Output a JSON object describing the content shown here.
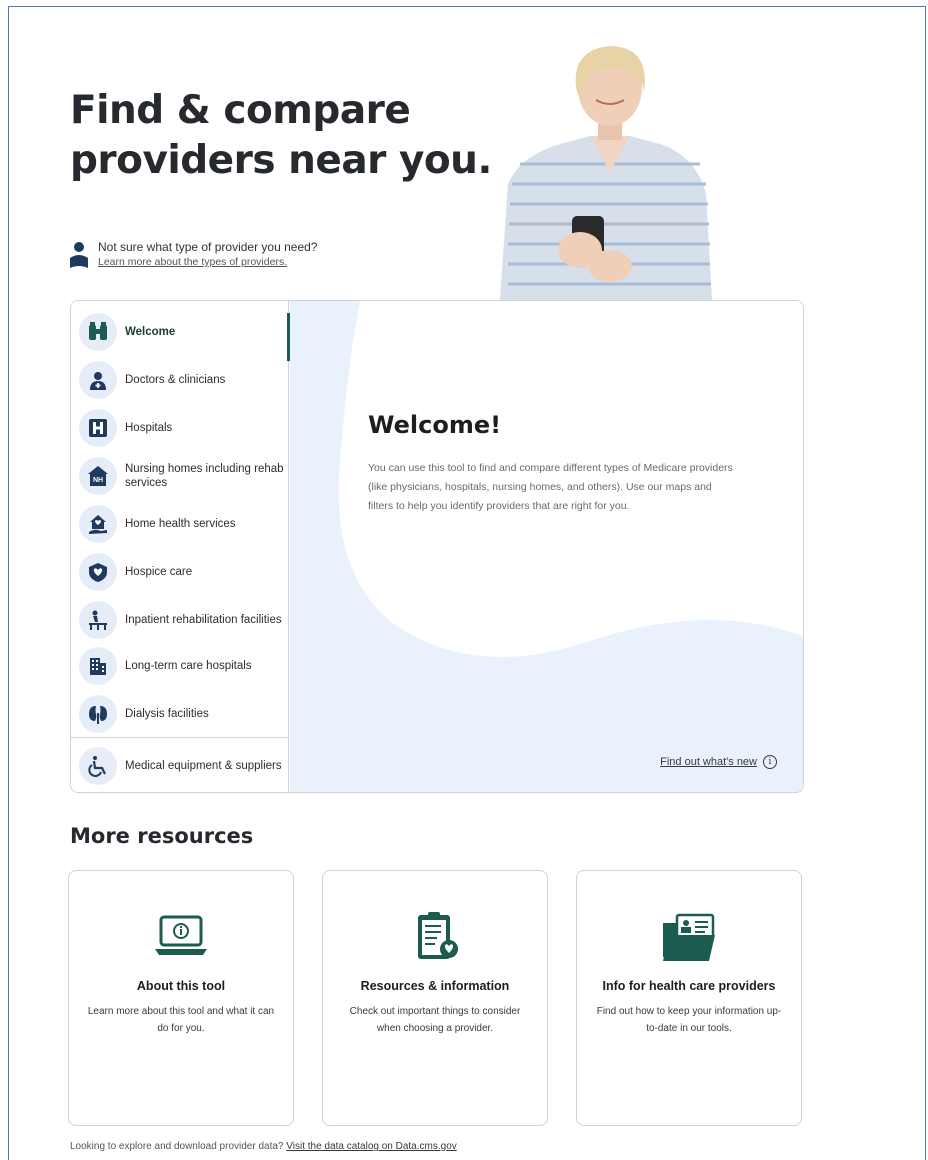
{
  "hero": {
    "title_line1": "Find & compare",
    "title_line2": "providers near you."
  },
  "help": {
    "question": "Not sure what type of provider you need?",
    "link": "Learn more about the types of providers."
  },
  "sidebar": {
    "items": [
      {
        "label": "Welcome",
        "icon": "binoculars-icon"
      },
      {
        "label": "Doctors & clinicians",
        "icon": "doctor-icon"
      },
      {
        "label": "Hospitals",
        "icon": "hospital-h-icon"
      },
      {
        "label": "Nursing homes including rehab services",
        "icon": "nursing-home-icon"
      },
      {
        "label": "Home health services",
        "icon": "home-health-icon"
      },
      {
        "label": "Hospice care",
        "icon": "hospice-heart-icon"
      },
      {
        "label": "Inpatient rehabilitation facilities",
        "icon": "rehab-facility-icon"
      },
      {
        "label": "Long-term care hospitals",
        "icon": "building-icon"
      },
      {
        "label": "Dialysis facilities",
        "icon": "kidney-icon"
      },
      {
        "label": "Medical equipment & suppliers",
        "icon": "wheelchair-icon"
      }
    ]
  },
  "welcome": {
    "heading": "Welcome!",
    "body": "You can use this tool to find and compare different types of Medicare providers (like physicians, hospitals, nursing homes, and others). Use our maps and filters to help you identify providers that are right for you.",
    "whats_new": "Find out what's new"
  },
  "resources": {
    "heading": "More resources",
    "cards": [
      {
        "title": "About this tool",
        "desc": "Learn more about this tool and what it can do for you.",
        "icon": "laptop-info-icon"
      },
      {
        "title": "Resources & information",
        "desc": "Check out important things to consider when choosing a provider.",
        "icon": "clipboard-heart-icon"
      },
      {
        "title": "Info for health care providers",
        "desc": "Find out how to keep your information up-to-date in our tools.",
        "icon": "folder-id-icon"
      }
    ]
  },
  "footer": {
    "text": "Looking to explore and download provider data?",
    "link": "Visit the data catalog on Data.cms.gov"
  },
  "colors": {
    "brand_green": "#1b5c4e",
    "icon_navy": "#1e3a5f",
    "panel_blue": "#e9f1fc"
  }
}
